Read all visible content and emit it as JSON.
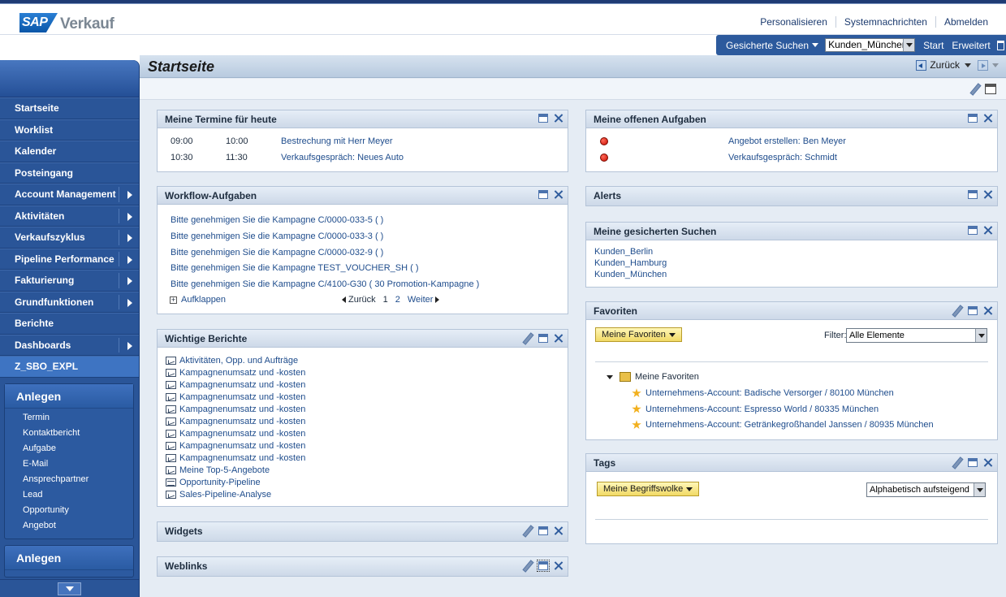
{
  "header": {
    "logo_text": "SAP",
    "app_title": "Verkauf",
    "links": [
      "Personalisieren",
      "Systemnachrichten",
      "Abmelden"
    ]
  },
  "search": {
    "saved_searches_label": "Gesicherte Suchen",
    "selected": "Kunden_München",
    "start": "Start",
    "advanced": "Erweitert"
  },
  "nav": {
    "items": [
      {
        "label": "Startseite",
        "submenu": false
      },
      {
        "label": "Worklist",
        "submenu": false
      },
      {
        "label": "Kalender",
        "submenu": false
      },
      {
        "label": "Posteingang",
        "submenu": false
      },
      {
        "label": "Account Management",
        "submenu": true
      },
      {
        "label": "Aktivitäten",
        "submenu": true
      },
      {
        "label": "Verkaufszyklus",
        "submenu": true
      },
      {
        "label": "Pipeline Performance",
        "submenu": true
      },
      {
        "label": "Fakturierung",
        "submenu": true
      },
      {
        "label": "Grundfunktionen",
        "submenu": true
      },
      {
        "label": "Berichte",
        "submenu": false
      },
      {
        "label": "Dashboards",
        "submenu": true
      },
      {
        "label": "Z_SBO_EXPL",
        "submenu": false,
        "active": true
      }
    ],
    "create1": {
      "title": "Anlegen",
      "links": [
        "Termin",
        "Kontaktbericht",
        "Aufgabe",
        "E-Mail",
        "Ansprechpartner",
        "Lead",
        "Opportunity",
        "Angebot"
      ]
    },
    "create2": {
      "title": "Anlegen"
    }
  },
  "page": {
    "title": "Startseite",
    "back": "Zurück"
  },
  "appointments": {
    "title": "Meine Termine für heute",
    "rows": [
      {
        "start": "09:00",
        "end": "10:00",
        "subject": "Bestrechung mit Herr Meyer"
      },
      {
        "start": "10:30",
        "end": "11:30",
        "subject": "Verkaufsgespräch: Neues Auto"
      }
    ]
  },
  "workflow": {
    "title": "Workflow-Aufgaben",
    "items": [
      "Bitte genehmigen Sie die Kampagne C/0000-033-5 ( )",
      "Bitte genehmigen Sie die Kampagne C/0000-033-3 ( )",
      "Bitte genehmigen Sie die Kampagne C/0000-032-9 ( )",
      "Bitte genehmigen Sie die Kampagne TEST_VOUCHER_SH ( )",
      "Bitte genehmigen Sie die Kampagne C/4100-G30 ( 30 Promotion-Kampagne )"
    ],
    "expand": "Aufklappen",
    "prev": "Zurück",
    "pages": [
      "1",
      "2"
    ],
    "next": "Weiter"
  },
  "reports": {
    "title": "Wichtige Berichte",
    "items": [
      {
        "label": "Aktivitäten, Opp. und Aufträge",
        "icon": "chart"
      },
      {
        "label": "Kampagnenumsatz und -kosten",
        "icon": "chart"
      },
      {
        "label": "Kampagnenumsatz und -kosten",
        "icon": "chart"
      },
      {
        "label": "Kampagnenumsatz und -kosten",
        "icon": "chart"
      },
      {
        "label": "Kampagnenumsatz und -kosten",
        "icon": "chart"
      },
      {
        "label": "Kampagnenumsatz und -kosten",
        "icon": "chart"
      },
      {
        "label": "Kampagnenumsatz und -kosten",
        "icon": "chart"
      },
      {
        "label": "Kampagnenumsatz und -kosten",
        "icon": "chart"
      },
      {
        "label": "Kampagnenumsatz und -kosten",
        "icon": "chart"
      },
      {
        "label": "Meine Top-5-Angebote",
        "icon": "chart"
      },
      {
        "label": "Opportunity-Pipeline",
        "icon": "table"
      },
      {
        "label": "Sales-Pipeline-Analyse",
        "icon": "chart"
      }
    ]
  },
  "widgets": {
    "title": "Widgets"
  },
  "weblinks": {
    "title": "Weblinks"
  },
  "tasks": {
    "title": "Meine offenen Aufgaben",
    "items": [
      "Angebot erstellen: Ben Meyer",
      "Verkaufsgespräch: Schmidt"
    ]
  },
  "alerts": {
    "title": "Alerts"
  },
  "saved_searches": {
    "title": "Meine gesicherten Suchen",
    "items": [
      "Kunden_Berlin",
      "Kunden_Hamburg",
      "Kunden_München"
    ]
  },
  "favorites": {
    "title": "Favoriten",
    "button": "Meine Favoriten",
    "filter_label": "Filter:",
    "filter_value": "Alle Elemente",
    "folder": "Meine Favoriten",
    "items": [
      "Unternehmens-Account: Badische Versorger / 80100 München",
      "Unternehmens-Account: Espresso World / 80335 München",
      "Unternehmens-Account: Getränkegroßhandel Janssen / 80935 München"
    ]
  },
  "tags": {
    "title": "Tags",
    "button": "Meine Begriffswolke",
    "sort_value": "Alphabetisch aufsteigend"
  }
}
